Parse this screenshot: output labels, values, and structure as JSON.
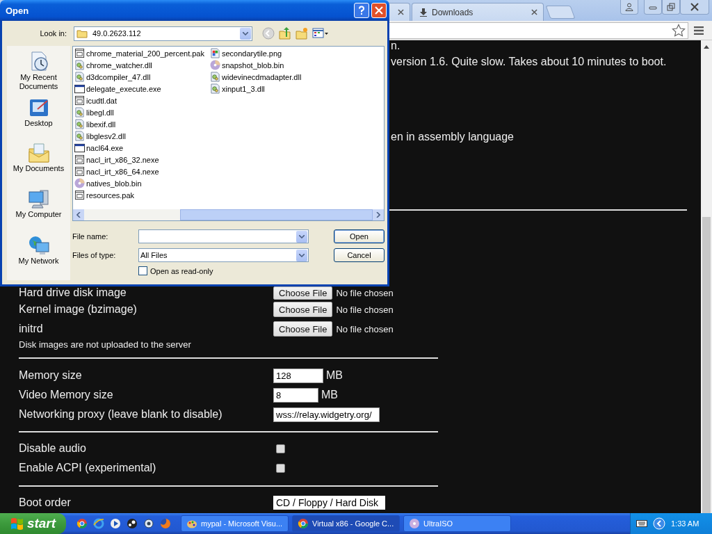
{
  "browser": {
    "tabs": [
      {
        "label": "Downloads",
        "selected": false
      }
    ]
  },
  "page": {
    "fragments": [
      "n.",
      "version 1.6. Quite slow. Takes about 10 minutes to boot.",
      "en in assembly language"
    ],
    "file_rows": [
      {
        "label": "Hard drive disk image",
        "button": "Choose File",
        "status": "No file chosen"
      },
      {
        "label": "Kernel image (bzimage)",
        "button": "Choose File",
        "status": "No file chosen"
      },
      {
        "label": "initrd",
        "button": "Choose File",
        "status": "No file chosen"
      }
    ],
    "note": "Disk images are not uploaded to the server",
    "settings": [
      {
        "label": "Memory size",
        "value": "128",
        "unit": "MB"
      },
      {
        "label": "Video Memory size",
        "value": "8",
        "unit": "MB"
      },
      {
        "label": "Networking proxy (leave blank to disable)",
        "value": "wss://relay.widgetry.org/"
      }
    ],
    "options": [
      {
        "label": "Disable audio",
        "checked": false
      },
      {
        "label": "Enable ACPI (experimental)",
        "checked": false
      }
    ],
    "boot_order": {
      "label": "Boot order",
      "value": "CD / Floppy / Hard Disk"
    }
  },
  "dialog": {
    "title": "Open",
    "look_in": {
      "label": "Look in:",
      "value": "49.0.2623.112"
    },
    "places": [
      {
        "label": "My Recent Documents",
        "kind": "recent"
      },
      {
        "label": "Desktop",
        "kind": "desktop"
      },
      {
        "label": "My Documents",
        "kind": "documents"
      },
      {
        "label": "My Computer",
        "kind": "computer"
      },
      {
        "label": "My Network",
        "kind": "network"
      }
    ],
    "files": [
      {
        "name": "chrome_material_200_percent.pak",
        "kind": "data"
      },
      {
        "name": "chrome_watcher.dll",
        "kind": "library"
      },
      {
        "name": "d3dcompiler_47.dll",
        "kind": "library"
      },
      {
        "name": "delegate_execute.exe",
        "kind": "program"
      },
      {
        "name": "icudtl.dat",
        "kind": "data"
      },
      {
        "name": "libegl.dll",
        "kind": "library"
      },
      {
        "name": "libexif.dll",
        "kind": "library"
      },
      {
        "name": "libglesv2.dll",
        "kind": "library"
      },
      {
        "name": "nacl64.exe",
        "kind": "program"
      },
      {
        "name": "nacl_irt_x86_32.nexe",
        "kind": "data"
      },
      {
        "name": "nacl_irt_x86_64.nexe",
        "kind": "data"
      },
      {
        "name": "natives_blob.bin",
        "kind": "disc"
      },
      {
        "name": "resources.pak",
        "kind": "data"
      },
      {
        "name": "secondarytile.png",
        "kind": "image"
      },
      {
        "name": "snapshot_blob.bin",
        "kind": "disc"
      },
      {
        "name": "widevinecdmadapter.dll",
        "kind": "library"
      },
      {
        "name": "xinput1_3.dll",
        "kind": "library"
      }
    ],
    "file_name": {
      "label": "File name:"
    },
    "file_type": {
      "label": "Files of type:",
      "value": "All Files"
    },
    "read_only": {
      "label": "Open as read-only",
      "checked": false
    },
    "buttons": [
      "Open",
      "Cancel"
    ]
  },
  "taskbar": {
    "start": "start",
    "tasks": [
      {
        "label": "mypal - Microsoft Visu...",
        "selected": false,
        "kind": "paint"
      },
      {
        "label": "Virtual x86 - Google C...",
        "selected": true,
        "kind": "chrome"
      },
      {
        "label": "UltraISO",
        "selected": false,
        "kind": "disc"
      }
    ],
    "clock": "1:33 AM"
  }
}
